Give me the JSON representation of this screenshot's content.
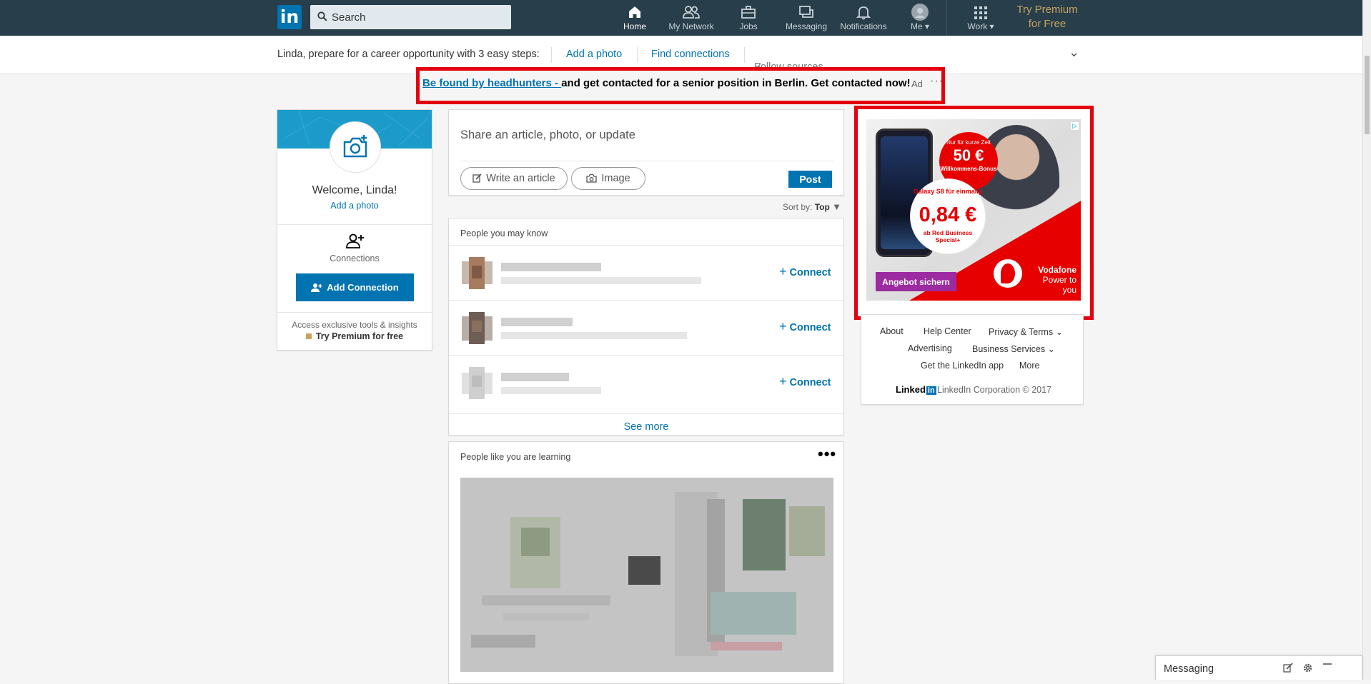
{
  "nav": {
    "logo": "in",
    "search_placeholder": "Search",
    "items": [
      {
        "label": "Home",
        "icon": "home-icon"
      },
      {
        "label": "My Network",
        "icon": "network-icon"
      },
      {
        "label": "Jobs",
        "icon": "briefcase-icon"
      },
      {
        "label": "Messaging",
        "icon": "chat-icon"
      },
      {
        "label": "Notifications",
        "icon": "bell-icon"
      },
      {
        "label": "Me",
        "icon": "avatar-icon"
      },
      {
        "label": "Work",
        "icon": "grid-icon"
      }
    ],
    "premium_line1": "Try Premium",
    "premium_line2": "for Free",
    "colors": {
      "bar": "#283e4a",
      "accent": "#0073b1",
      "premium": "#c8a35f"
    }
  },
  "subbar": {
    "prompt": "Linda, prepare for a career opportunity with 3 easy steps:",
    "add_photo": "Add a photo",
    "find_connections": "Find connections",
    "follow_sources": "Follow sources"
  },
  "text_ad": {
    "link": "Be found by headhunters - ",
    "text": "and get contacted for a senior position in Berlin. Get contacted now!",
    "ad_label": "Ad",
    "dots": "···",
    "highlight_color": "#e4000f"
  },
  "profile": {
    "welcome": "Welcome, Linda!",
    "add_photo": "Add a photo",
    "connections_label": "Connections",
    "add_connection": "Add Connection",
    "access_text": "Access exclusive tools & insights",
    "try_premium": "Try Premium for free"
  },
  "share": {
    "placeholder": "Share an article, photo, or update",
    "write_article": "Write an article",
    "image": "Image",
    "post": "Post",
    "sort_label": "Sort by:",
    "sort_value": "Top"
  },
  "pymk": {
    "title": "People you may know",
    "connect_label": "Connect",
    "see_more": "See more"
  },
  "learning": {
    "title": "People like you are learning",
    "menu": "•••"
  },
  "right_ad": {
    "promo_small": "Nur für kurze Zeit",
    "promo_big": "50 €",
    "promo_bonus": "Willkommens-Bonus",
    "device": "Galaxy S8 für einmalig",
    "price": "0,84 €",
    "plan": "ab Red Business Special+",
    "cta": "Angebot sichern",
    "brand": "Vodafone",
    "tagline": "Power to you",
    "brand_color": "#e60000"
  },
  "footer": {
    "about": "About",
    "help_center": "Help Center",
    "privacy": "Privacy & Terms",
    "advertising": "Advertising",
    "business": "Business Services",
    "app": "Get the LinkedIn app",
    "more": "More",
    "logo_text": "Linked",
    "logo_in": "in",
    "copyright": "LinkedIn Corporation © 2017"
  },
  "messaging": {
    "label": "Messaging"
  }
}
